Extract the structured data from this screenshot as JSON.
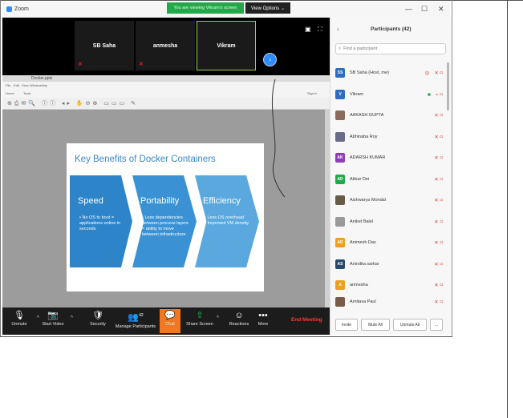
{
  "window": {
    "app_name": "Zoom",
    "viewing_banner": "You are viewing Vikram's screen",
    "view_options": "View Options ⌄",
    "controls": [
      "—",
      "☐",
      "✕"
    ]
  },
  "video_strip": {
    "tiles": [
      {
        "name": "SB Saha",
        "muted": true
      },
      {
        "name": "anmesha",
        "muted": true
      },
      {
        "name": "Vikram",
        "muted": false
      }
    ],
    "next_label": "›"
  },
  "presentation": {
    "slide_title": "Key Benefits of Docker Containers",
    "tab_file": "Docker.pptx",
    "menu_items": [
      "File",
      "Edit",
      "View",
      "Window",
      "Help"
    ],
    "ribbon_tabs": [
      "Home",
      "Tools"
    ],
    "sign_in": "Sign In",
    "benefits": [
      {
        "heading": "Speed",
        "bullets": [
          "No OS to boot = applications online in seconds"
        ]
      },
      {
        "heading": "Portability",
        "bullets": [
          "Less dependencies between process layers = ability to move between infrastructure"
        ]
      },
      {
        "heading": "Efficiency",
        "bullets": [
          "Less OS overhead",
          "Improved VM density"
        ]
      }
    ]
  },
  "toolbar": {
    "buttons": [
      {
        "label": "Unmute",
        "icon": "🎙"
      },
      {
        "label": "Start Video",
        "icon": "📷"
      },
      {
        "label": "Security",
        "icon": "🛡"
      },
      {
        "label": "Manage Participants",
        "icon": "👥",
        "count": "42"
      },
      {
        "label": "Chat",
        "icon": "💬"
      },
      {
        "label": "Share Screen",
        "icon": "⇧"
      },
      {
        "label": "Reactions",
        "icon": "☺"
      },
      {
        "label": "More",
        "icon": "•••"
      }
    ],
    "end_meeting": "End Meeting"
  },
  "participants": {
    "title": "Participants (42)",
    "search_placeholder": "Find a participant",
    "people": [
      {
        "initials": "SS",
        "name": "SB Saha (Host, me)",
        "color": "#2d6cc0"
      },
      {
        "initials": "V",
        "name": "Vikram",
        "color": "#2d6cc0"
      },
      {
        "initials": "",
        "name": "AAKASH GUPTA",
        "color": "#8a6a5a"
      },
      {
        "initials": "",
        "name": "Abhinaba Roy",
        "color": "#6a6a8a"
      },
      {
        "initials": "AK",
        "name": "ADARSH KUMAR",
        "color": "#8e3fb5"
      },
      {
        "initials": "AD",
        "name": "Akbar Dei",
        "color": "#23a84a"
      },
      {
        "initials": "",
        "name": "Aishwarya Mondal",
        "color": "#6a5a4a"
      },
      {
        "initials": "",
        "name": "Aniket Balel",
        "color": "#9a9a9a"
      },
      {
        "initials": "AD",
        "name": "Animesh Das",
        "color": "#f0a020"
      },
      {
        "initials": "AS",
        "name": "Anindita sarkar",
        "color": "#2a4a6a"
      },
      {
        "initials": "A",
        "name": "anmesha",
        "color": "#f0a020"
      },
      {
        "initials": "",
        "name": "Arnitava Paul",
        "color": "#7a5a4a"
      }
    ],
    "footer": [
      "Invite",
      "Mute All",
      "Unmute All",
      "..."
    ]
  }
}
